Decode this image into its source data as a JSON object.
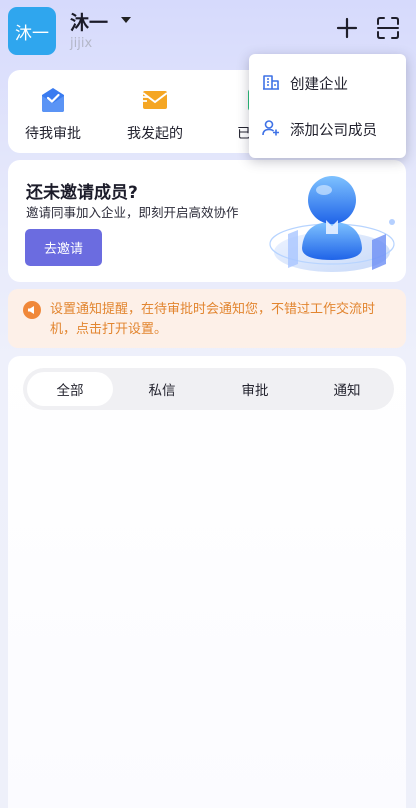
{
  "header": {
    "avatar_text": "沐一",
    "user_name": "沐一",
    "user_id": "jijix",
    "icons": [
      "plus-icon",
      "scan-icon"
    ]
  },
  "quick_actions": [
    {
      "label": "待我审批",
      "icon": "approval-envelope-icon",
      "color": "#3a7bf0"
    },
    {
      "label": "我发起的",
      "icon": "sent-envelope-icon",
      "color": "#f5a623"
    },
    {
      "label": "已处理",
      "icon": "done-icon",
      "color": "#27c07a"
    }
  ],
  "dropdown_menu": {
    "items": [
      {
        "label": "创建企业",
        "icon": "building-icon"
      },
      {
        "label": "添加公司成员",
        "icon": "add-user-icon"
      }
    ]
  },
  "invite_card": {
    "title": "还未邀请成员?",
    "description": "邀请同事加入企业，即刻开启高效协作",
    "button_label": "去邀请"
  },
  "notice": {
    "text": "设置通知提醒，在待审批时会通知您，不错过工作交流时机，点击打开设置。",
    "icon": "megaphone-icon"
  },
  "message_tabs": {
    "items": [
      "全部",
      "私信",
      "审批",
      "通知"
    ],
    "active": "全部"
  },
  "colors": {
    "accent": "#6b6ce0",
    "avatar": "#2fa6ee",
    "notice_text": "#e2852f",
    "notice_bg": "#fdf0e8"
  }
}
